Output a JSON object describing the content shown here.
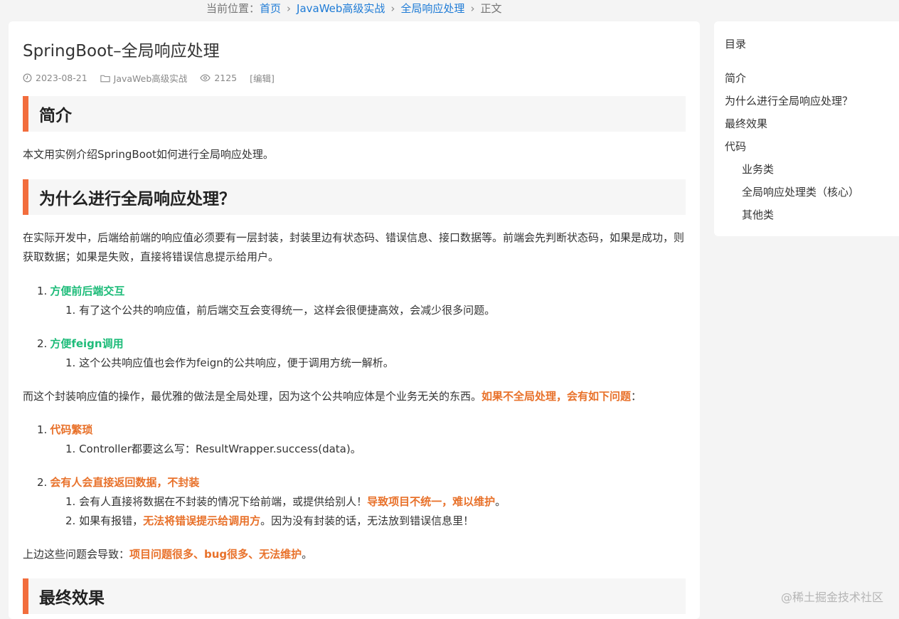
{
  "breadcrumb": {
    "prefix": "当前位置：",
    "home": "首页",
    "category": "JavaWeb高级实战",
    "subcategory": "全局响应处理",
    "current": "正文"
  },
  "article": {
    "title": "SpringBoot–全局响应处理",
    "date": "2023-08-21",
    "category": "JavaWeb高级实战",
    "views": "2125",
    "edit": "[编辑]"
  },
  "sections": {
    "intro_heading": "简介",
    "intro_text": "本文用实例介绍SpringBoot如何进行全局响应处理。",
    "why_heading": "为什么进行全局响应处理？",
    "why_text": "在实际开发中，后端给前端的响应值必须要有一层封装，封装里边有状态码、错误信息、接口数据等。前端会先判断状态码，如果是成功，则获取数据；如果是失败，直接将错误信息提示给用户。",
    "benefits": [
      {
        "num": "1.",
        "title": "方便前后端交互",
        "sub": "1. 有了这个公共的响应值，前后端交互会变得统一，这样会很便捷高效，会减少很多问题。"
      },
      {
        "num": "2.",
        "title": "方便feign调用",
        "sub": "1. 这个公共响应值也会作为feign的公共响应，便于调用方统一解析。"
      }
    ],
    "global_text_prefix": "而这个封装响应值的操作，最优雅的做法是全局处理，因为这个公共响应体是个业务无关的东西。",
    "global_text_emph": "如果不全局处理，会有如下问题",
    "global_text_suffix": "：",
    "problems": {
      "p1_num": "1.",
      "p1_title": "代码繁琐",
      "p1_sub": "1. Controller都要这么写：ResultWrapper.success(data)。",
      "p2_num": "2.",
      "p2_title": "会有人会直接返回数据，不封装",
      "p2_sub1_prefix": "1. 会有人直接将数据在不封装的情况下给前端，或提供给别人！",
      "p2_sub1_emph": "导致项目不统一，难以维护",
      "p2_sub1_suffix": "。",
      "p2_sub2_prefix": "2. 如果有报错，",
      "p2_sub2_emph": "无法将错误提示给调用方",
      "p2_sub2_suffix": "。因为没有封装的话，无法放到错误信息里！"
    },
    "result_prefix": "上边这些问题会导致：",
    "result_emph": "项目问题很多、bug很多、无法维护",
    "result_suffix": "。",
    "final_heading": "最终效果"
  },
  "toc": {
    "title": "目录",
    "items": [
      "简介",
      "为什么进行全局响应处理？",
      "最终效果",
      "代码"
    ],
    "subitems": [
      "业务类",
      "全局响应处理类（核心）",
      "其他类"
    ]
  },
  "watermark": "@稀土掘金技术社区",
  "colors": {
    "accent_bar": "#f26d3d",
    "link": "#1e7bd6",
    "green": "#1fbc7a",
    "orange": "#e8712a"
  }
}
